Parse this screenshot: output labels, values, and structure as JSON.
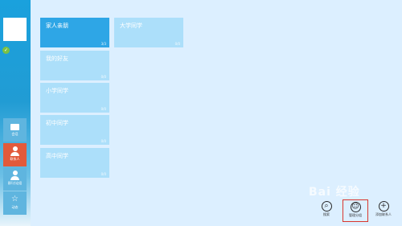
{
  "sidebar": {
    "nav": [
      {
        "label": "会话",
        "icon": "chat-bubble-icon",
        "active": false
      },
      {
        "label": "联系人",
        "icon": "person-icon",
        "active": true
      },
      {
        "label": "群/讨论组",
        "icon": "group-icon",
        "active": false
      },
      {
        "label": "动态",
        "icon": "star-icon",
        "active": false
      }
    ]
  },
  "groups": [
    {
      "name": "家人亲朋",
      "count": "3/3",
      "selected": true
    },
    {
      "name": "大学同学",
      "count": "0/0",
      "selected": false
    },
    {
      "name": "我的好友",
      "count": "0/0",
      "selected": false
    },
    {
      "name": "小学同学",
      "count": "0/0",
      "selected": false
    },
    {
      "name": "初中同学",
      "count": "0/0",
      "selected": false
    },
    {
      "name": "高中同学",
      "count": "0/0",
      "selected": false
    }
  ],
  "actions": [
    {
      "label": "搜索",
      "icon": "search-icon"
    },
    {
      "label": "管理分组",
      "icon": "manage-groups-icon"
    },
    {
      "label": "添加联系人",
      "icon": "add-icon"
    }
  ],
  "watermark": {
    "text": "Bai 经验"
  },
  "colors": {
    "sidebar": "#219cd4",
    "active_nav": "#e25a3b",
    "tile": "#acdffa",
    "tile_selected": "#2ea6e6",
    "highlight_border": "#d9362d"
  }
}
